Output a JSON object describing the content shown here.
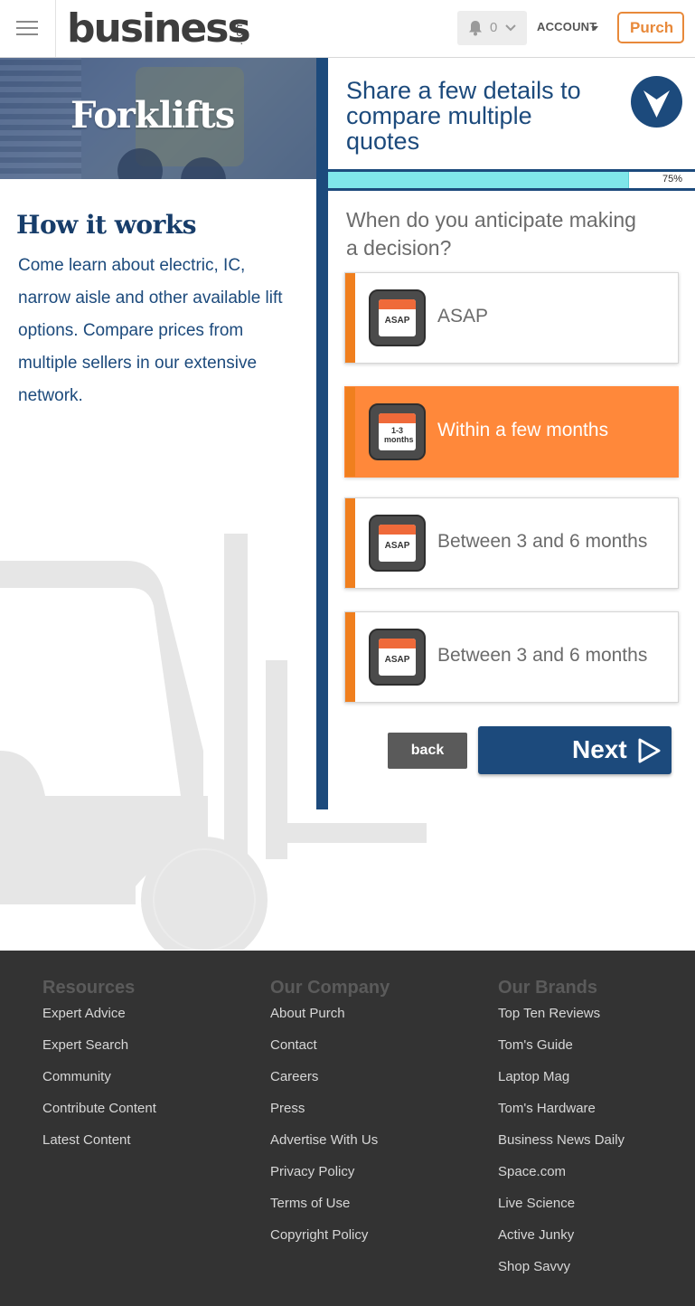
{
  "header": {
    "logo": "business",
    "logo_suffix": ".com",
    "notification_count": "0",
    "account_label": "ACCOUNT",
    "purch_label": "Purch"
  },
  "hero": {
    "title": "Forklifts"
  },
  "how_it_works": {
    "title": "How it works",
    "text": "Come learn about electric, IC, narrow aisle and other available lift options. Compare prices from multiple sellers in our extensive network."
  },
  "form": {
    "title": "Share a few details to compare multiple quotes",
    "progress_label": "75%",
    "progress_value": 0.82,
    "question": "When do you anticipate making a decision?",
    "options": [
      {
        "label": "ASAP",
        "icon": "calendar-asap-icon",
        "icon_text": "ASAP",
        "selected": false
      },
      {
        "label": "Within a few months",
        "icon": "calendar-1-3-months-icon",
        "icon_text": "1-3 months",
        "selected": true
      },
      {
        "label": "Between 3 and 6 months",
        "icon": "calendar-asap-icon",
        "icon_text": "ASAP",
        "selected": false
      },
      {
        "label": "Between 3 and 6 months",
        "icon": "calendar-asap-icon",
        "icon_text": "ASAP",
        "selected": false
      }
    ],
    "back_label": "back",
    "next_label": "Next"
  },
  "footer": {
    "resources": {
      "heading": "Resources",
      "links": [
        "Expert Advice",
        "Expert Search",
        "Community",
        "Contribute Content",
        "Latest Content"
      ]
    },
    "company": {
      "heading": "Our Company",
      "links": [
        "About Purch",
        "Contact",
        "Careers",
        "Press",
        "Advertise With Us",
        "Privacy Policy",
        "Terms of Use",
        "Copyright Policy"
      ]
    },
    "brands": {
      "heading": "Our Brands",
      "links": [
        "Top Ten Reviews",
        "Tom's Guide",
        "Laptop Mag",
        "Tom's Hardware",
        "Business News Daily",
        "Space.com",
        "Live Science",
        "Active Junky",
        "Shop Savvy"
      ]
    }
  },
  "colors": {
    "brand_blue": "#1c4a7c",
    "accent_orange": "#ff883a",
    "progress_fill": "#7fe6ea",
    "footer_bg": "#333333"
  }
}
